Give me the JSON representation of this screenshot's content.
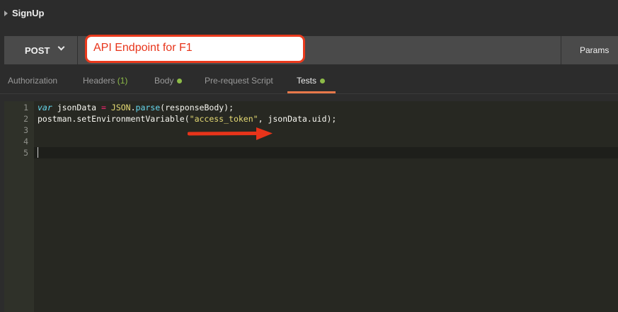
{
  "title": {
    "text": "SignUp"
  },
  "request": {
    "method": "POST",
    "params_label": "Params"
  },
  "annotation": {
    "callout_text": "API Endpoint for F1",
    "color": "#ea3a1d"
  },
  "tabs": [
    {
      "label": "Authorization"
    },
    {
      "label": "Headers",
      "count": "(1)"
    },
    {
      "label": "Body",
      "indicator": "green-dot"
    },
    {
      "label": "Pre-request Script"
    },
    {
      "label": "Tests",
      "indicator": "green-dot",
      "active": true
    }
  ],
  "editor": {
    "line_numbers": [
      "1",
      "2",
      "3",
      "4",
      "5"
    ],
    "line1": {
      "kw": "var",
      "ident": " jsonData ",
      "op": "=",
      "sp": " ",
      "obj": "JSON",
      "dot": ".",
      "fn": "parse",
      "rest": "(responseBody);"
    },
    "line2": {
      "pre": "postman.setEnvironmentVariable(",
      "str": "\"access_token\"",
      "post": ", jsonData.uid);"
    }
  },
  "colors": {
    "accent_tab": "#e8784a",
    "indicator": "#8dbb48",
    "editor_bg": "#272822"
  }
}
